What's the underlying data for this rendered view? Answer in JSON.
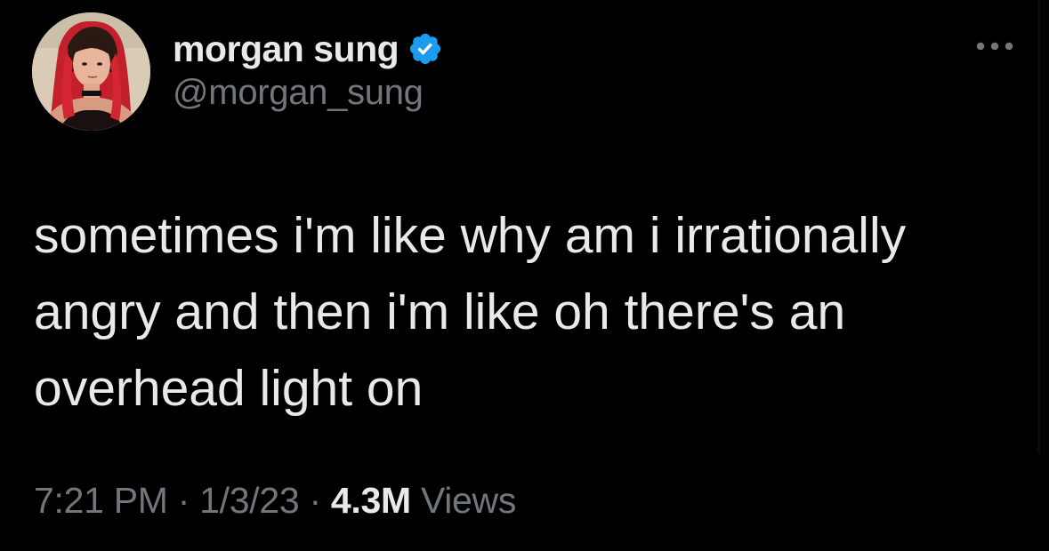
{
  "author": {
    "display_name": "morgan sung",
    "handle": "@morgan_sung",
    "verified": true,
    "verified_color": "#1d9bf0"
  },
  "tweet": {
    "text": "sometimes i'm like why am i irrationally\nangry and then i'm like oh there's an\noverhead light on"
  },
  "meta": {
    "time": "7:21 PM",
    "separator": "·",
    "date": "1/3/23",
    "views_count": "4.3M",
    "views_label": "Views"
  },
  "icons": {
    "verified": "verified-badge-icon",
    "more": "more-options-icon"
  },
  "colors": {
    "background": "#000000",
    "primary_text": "#e7e9ea",
    "secondary_text": "#71767b",
    "accent": "#1d9bf0"
  }
}
